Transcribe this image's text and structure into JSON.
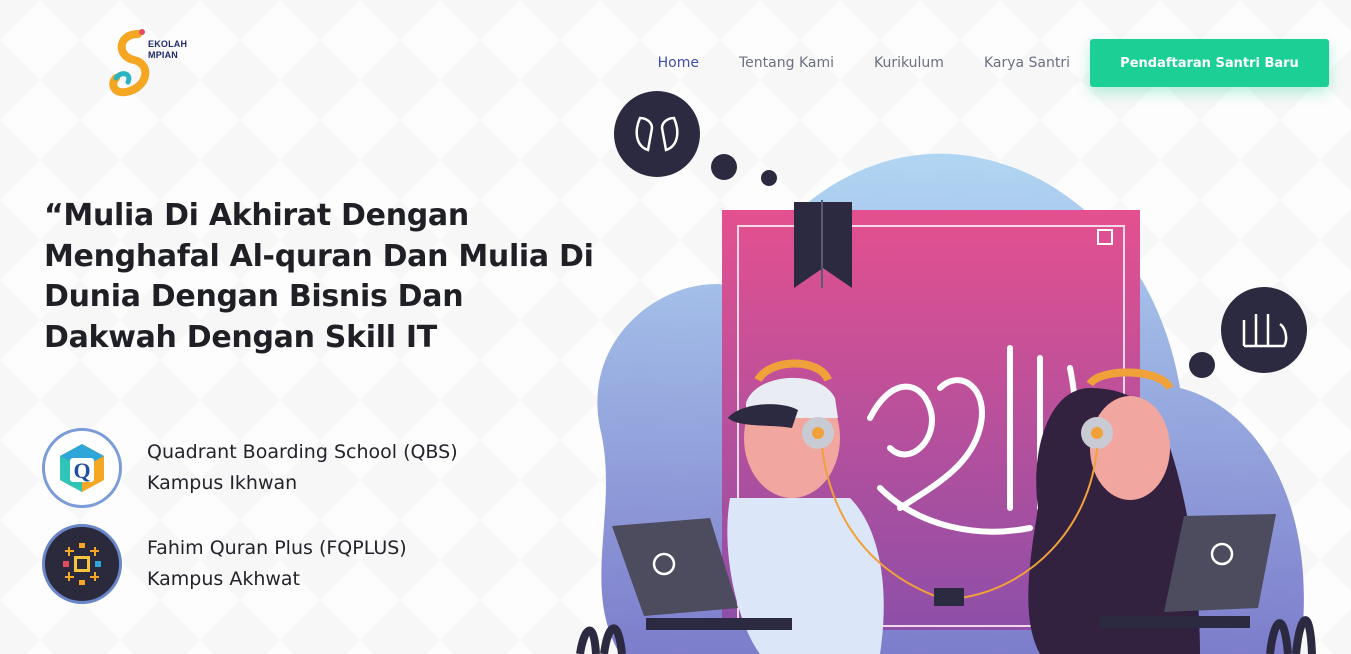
{
  "brand": {
    "logo_line1": "EKOLAH",
    "logo_line2": "MPIAN"
  },
  "nav": {
    "items": [
      {
        "label": "Home",
        "active": true
      },
      {
        "label": "Tentang Kami",
        "active": false
      },
      {
        "label": "Kurikulum",
        "active": false
      },
      {
        "label": "Karya Santri",
        "active": false
      }
    ],
    "cta_label": "Pendaftaran Santri Baru"
  },
  "hero": {
    "headline": "“Mulia Di Akhirat Dengan Menghafal Al-quran Dan Mulia Di Dunia Dengan Bisnis Dan Dakwah Dengan Skill IT",
    "campuses": [
      {
        "name": "Quadrant Boarding School (QBS)",
        "sub": "Kampus Ikhwan",
        "logo_icon": "qbs-logo-icon"
      },
      {
        "name": "Fahim Quran Plus (FQPLUS)",
        "sub": "Kampus Akhwat",
        "logo_icon": "fqplus-logo-icon"
      }
    ]
  },
  "colors": {
    "accent": "#1ccf95",
    "nav_active": "#3e4ea8",
    "text_dark": "#1f1f26",
    "book_pink": "#e0508e",
    "blob_blue": "#a9c8ef"
  }
}
